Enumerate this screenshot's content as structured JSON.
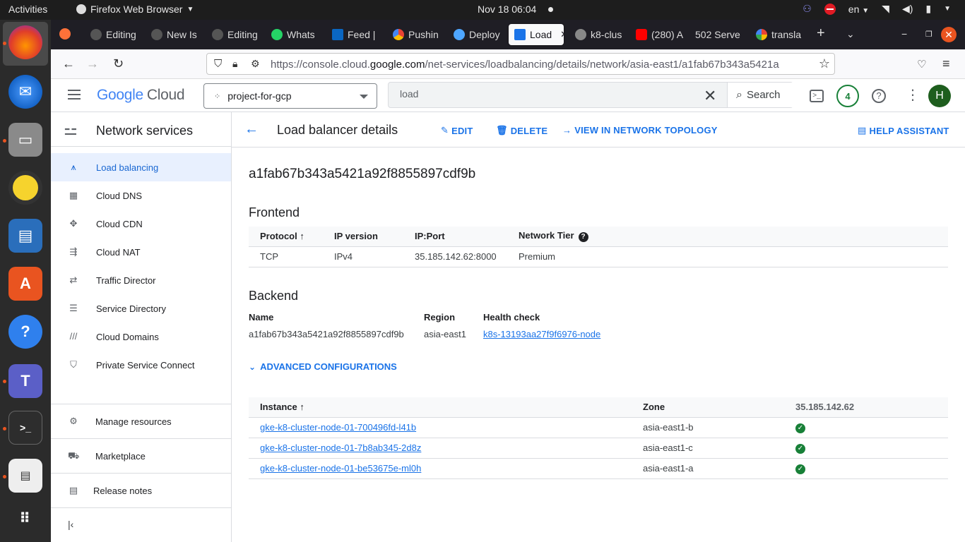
{
  "system": {
    "activities": "Activities",
    "app_name": "Firefox Web Browser",
    "clock": "Nov 18  06:04",
    "lang": "en"
  },
  "browser": {
    "tabs": [
      {
        "label": "Editing",
        "icon": "github-icon",
        "color": "#ffffff"
      },
      {
        "label": "New Is",
        "icon": "github-icon",
        "color": "#ffffff"
      },
      {
        "label": "Editing",
        "icon": "github-icon",
        "color": "#ffffff"
      },
      {
        "label": "Whats",
        "icon": "whatsapp-icon",
        "color": "#25d366"
      },
      {
        "label": "Feed |",
        "icon": "linkedin-icon",
        "color": "#0a66c2"
      },
      {
        "label": "Pushin",
        "icon": "gcp-icon",
        "color": "#4285f4"
      },
      {
        "label": "Deploy",
        "icon": "octopus-icon",
        "color": "#4ea6ff"
      },
      {
        "label": "Load",
        "icon": "network-icon",
        "color": "#1a73e8"
      },
      {
        "label": "k8-clus",
        "icon": "gear-icon",
        "color": "#bbbbbb"
      },
      {
        "label": "(280) A",
        "icon": "youtube-icon",
        "color": "#ff0000"
      },
      {
        "label": "502 Serve",
        "icon": "none",
        "color": "#ffffff"
      },
      {
        "label": "transla",
        "icon": "google-icon",
        "color": "#ffffff"
      }
    ],
    "url_prefix": "https://console.cloud.",
    "url_domain": "google.com",
    "url_suffix": "/net-services/loadbalancing/details/network/asia-east1/a1fab67b343a5421a"
  },
  "header": {
    "logo_google": "Google",
    "logo_cloud": "Cloud",
    "project": "project-for-gcp",
    "search_value": "load",
    "search_label": "Search",
    "notifications": "4",
    "avatar": "H"
  },
  "sidebar": {
    "title": "Network services",
    "items": [
      {
        "label": "Load balancing",
        "icon": "load-balancing-icon"
      },
      {
        "label": "Cloud DNS",
        "icon": "dns-icon"
      },
      {
        "label": "Cloud CDN",
        "icon": "cdn-icon"
      },
      {
        "label": "Cloud NAT",
        "icon": "nat-icon"
      },
      {
        "label": "Traffic Director",
        "icon": "traffic-director-icon"
      },
      {
        "label": "Service Directory",
        "icon": "service-directory-icon"
      },
      {
        "label": "Cloud Domains",
        "icon": "domains-icon"
      },
      {
        "label": "Private Service Connect",
        "icon": "shield-icon"
      }
    ],
    "footer": [
      {
        "label": "Manage resources",
        "icon": "manage-resources-icon"
      },
      {
        "label": "Marketplace",
        "icon": "cart-icon"
      },
      {
        "label": "Release notes",
        "icon": "notes-icon"
      }
    ]
  },
  "main": {
    "title": "Load balancer details",
    "actions": {
      "edit": "EDIT",
      "delete": "DELETE",
      "topology": "VIEW IN NETWORK TOPOLOGY",
      "help": "HELP ASSISTANT"
    },
    "lb_name": "a1fab67b343a5421a92f8855897cdf9b",
    "frontend": {
      "title": "Frontend",
      "headers": [
        "Protocol",
        "IP version",
        "IP:Port",
        "Network Tier"
      ],
      "rows": [
        [
          "TCP",
          "IPv4",
          "35.185.142.62:8000",
          "Premium"
        ]
      ]
    },
    "backend": {
      "title": "Backend",
      "name_label": "Name",
      "name_value": "a1fab67b343a5421a92f8855897cdf9b",
      "region_label": "Region",
      "region_value": "asia-east1",
      "health_label": "Health check",
      "health_value": "k8s-13193aa27f9f6976-node"
    },
    "advanced": "ADVANCED CONFIGURATIONS",
    "instances": {
      "headers": [
        "Instance",
        "Zone",
        "35.185.142.62"
      ],
      "rows": [
        [
          "gke-k8-cluster-node-01-700496fd-l41b",
          "asia-east1-b"
        ],
        [
          "gke-k8-cluster-node-01-7b8ab345-2d8z",
          "asia-east1-c"
        ],
        [
          "gke-k8-cluster-node-01-be53675e-ml0h",
          "asia-east1-a"
        ]
      ]
    }
  }
}
